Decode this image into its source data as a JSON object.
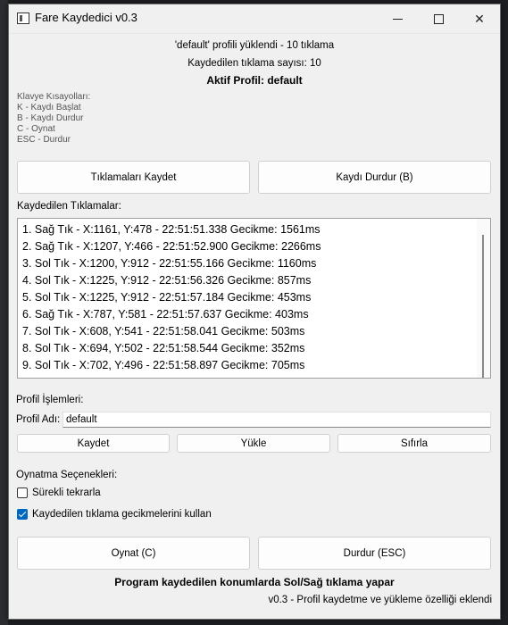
{
  "window": {
    "title": "Fare Kaydedici v0.3",
    "minimize_glyph": "—",
    "maximize_glyph": "□",
    "close_glyph": "✕"
  },
  "status": {
    "profile_loaded": "'default' profili yüklendi - 10 tıklama",
    "click_count": "Kaydedilen tıklama sayısı: 10",
    "active_profile": "Aktif Profil: default"
  },
  "shortcuts": {
    "title": "Klavye Kısayolları:",
    "items": [
      "K - Kaydı Başlat",
      "B - Kaydı Durdur",
      "C - Oynat",
      "ESC - Durdur"
    ]
  },
  "record": {
    "start_label": "Tıklamaları Kaydet",
    "stop_label": "Kaydı Durdur (B)"
  },
  "clicks": {
    "title": "Kaydedilen Tıklamalar:",
    "items": [
      "1. Sağ Tık - X:1161, Y:478 - 22:51:51.338 Gecikme: 1561ms",
      "2. Sağ Tık - X:1207, Y:466 - 22:51:52.900 Gecikme: 2266ms",
      "3. Sol Tık - X:1200, Y:912 - 22:51:55.166 Gecikme: 1160ms",
      "4. Sol Tık - X:1225, Y:912 - 22:51:56.326 Gecikme: 857ms",
      "5. Sol Tık - X:1225, Y:912 - 22:51:57.184 Gecikme: 453ms",
      "6. Sağ Tık - X:787, Y:581 - 22:51:57.637 Gecikme: 403ms",
      "7. Sol Tık - X:608, Y:541 - 22:51:58.041 Gecikme: 503ms",
      "8. Sol Tık - X:694, Y:502 - 22:51:58.544 Gecikme: 352ms",
      "9. Sol Tık - X:702, Y:496 - 22:51:58.897 Gecikme: 705ms"
    ]
  },
  "profile": {
    "section_title": "Profil İşlemleri:",
    "name_label": "Profil Adı:",
    "name_value": "default",
    "save_label": "Kaydet",
    "load_label": "Yükle",
    "reset_label": "Sıfırla"
  },
  "playback": {
    "section_title": "Oynatma Seçenekleri:",
    "repeat_label": "Sürekli tekrarla",
    "repeat_checked": false,
    "use_delays_label": "Kaydedilen tıklama gecikmelerini kullan",
    "use_delays_checked": true,
    "play_label": "Oynat (C)",
    "stop_label": "Durdur (ESC)"
  },
  "footer": {
    "info": "Program kaydedilen konumlarda Sol/Sağ tıklama yapar",
    "version": "v0.3 - Profil kaydetme ve yükleme özelliği eklendi"
  },
  "colors": {
    "accent": "#0067c0",
    "window_bg": "#f0f0f0"
  }
}
